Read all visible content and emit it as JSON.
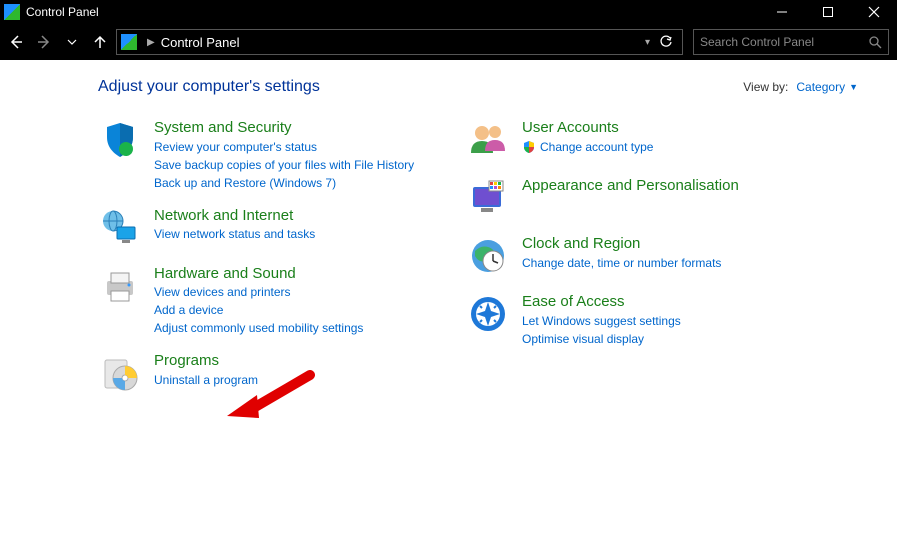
{
  "window": {
    "title": "Control Panel"
  },
  "nav": {
    "location": "Control Panel",
    "search_placeholder": "Search Control Panel"
  },
  "header": {
    "heading": "Adjust your computer's settings",
    "viewby_label": "View by:",
    "viewby_value": "Category"
  },
  "left": [
    {
      "title": "System and Security",
      "links": [
        "Review your computer's status",
        "Save backup copies of your files with File History",
        "Back up and Restore (Windows 7)"
      ]
    },
    {
      "title": "Network and Internet",
      "links": [
        "View network status and tasks"
      ]
    },
    {
      "title": "Hardware and Sound",
      "links": [
        "View devices and printers",
        "Add a device",
        "Adjust commonly used mobility settings"
      ]
    },
    {
      "title": "Programs",
      "links": [
        "Uninstall a program"
      ]
    }
  ],
  "right": [
    {
      "title": "User Accounts",
      "links": [
        {
          "text": "Change account type",
          "shield": true
        }
      ]
    },
    {
      "title": "Appearance and Personalisation",
      "links": []
    },
    {
      "title": "Clock and Region",
      "links": [
        "Change date, time or number formats"
      ]
    },
    {
      "title": "Ease of Access",
      "links": [
        "Let Windows suggest settings",
        "Optimise visual display"
      ]
    }
  ]
}
